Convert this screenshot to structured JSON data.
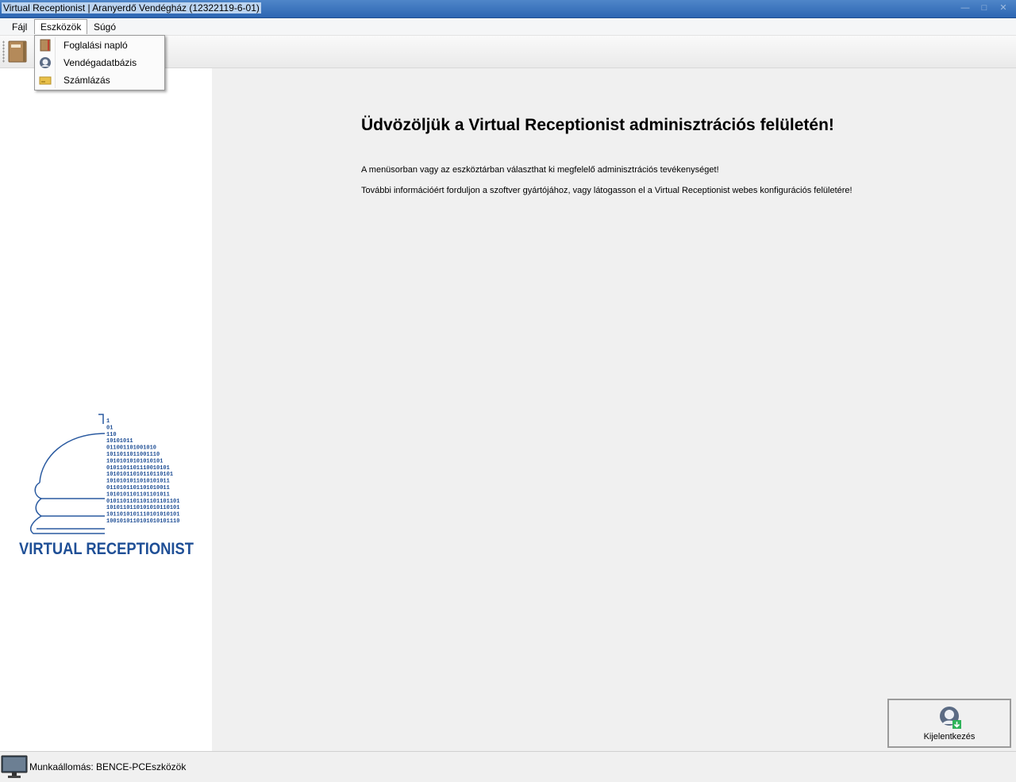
{
  "window": {
    "title": "Virtual Receptionist | Aranyerdő Vendégház (12322119-6-01)",
    "controls": [
      "—",
      "□",
      "✕"
    ]
  },
  "menubar": {
    "items": [
      {
        "label": "Fájl"
      },
      {
        "label": "Eszközök"
      },
      {
        "label": "Súgó"
      }
    ]
  },
  "dropdown": {
    "items": [
      {
        "label": "Foglalási napló",
        "icon": "book-icon"
      },
      {
        "label": "Vendégadatbázis",
        "icon": "user-icon"
      },
      {
        "label": "Számlázás",
        "icon": "invoice-icon"
      }
    ]
  },
  "logo": {
    "text": "VIRTUAL RECEPTIONIST",
    "binary_lines": [
      "1",
      "01",
      "110",
      "10101011",
      "011001101001010",
      "1011011011001110",
      "10101010101010101",
      "0101101101110010101",
      "10101011010110110101",
      "1010101011010101011",
      "0110101101101010011",
      "1010101101101101011",
      "0101101101101101101101",
      "1010110110101010110101",
      "1011010101110101010101",
      "1001010110101010101110"
    ],
    "accent_color": "#1f4f96"
  },
  "main": {
    "welcome_title": "Üdvözöljük a Virtual Receptionist adminisztrációs felületén!",
    "info_line1": "A menüsorban vagy az eszköztárban választhat ki megfelelő adminisztrációs tevékenységet!",
    "info_line2": "További információért forduljon a szoftver gyártójához, vagy látogasson el a Virtual Receptionist webes konfigurációs felületére!"
  },
  "logout_button": {
    "label": "Kijelentkezés"
  },
  "statusbar": {
    "workstation": "Munkaállomás: BENCE-PC",
    "section": "Eszközök"
  }
}
